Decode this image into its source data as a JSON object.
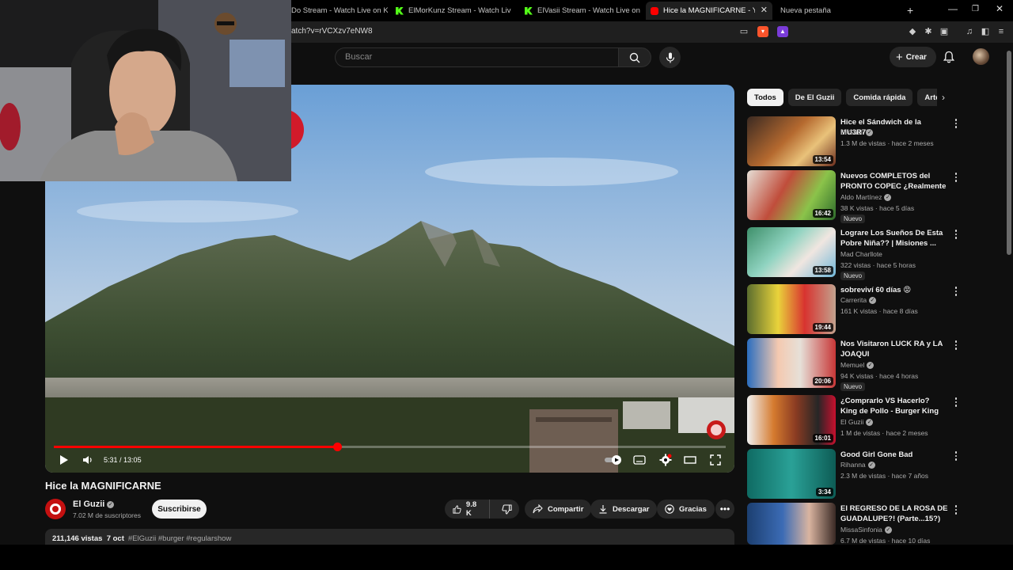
{
  "browser": {
    "tabs": [
      {
        "label": "Do Stream - Watch Live on Kick",
        "favicon": "kick-icon",
        "active": false
      },
      {
        "label": "ElMorKunz Stream - Watch Live on Kick",
        "favicon": "kick-icon",
        "active": false
      },
      {
        "label": "ElVasii Stream - Watch Live on Kick",
        "favicon": "kick-icon",
        "active": false
      },
      {
        "label": "Hice la MAGNIFICARNE - YouTube",
        "favicon": "youtube-icon",
        "active": true
      },
      {
        "label": "Nueva pestaña",
        "favicon": "",
        "active": false
      }
    ],
    "url": "atch?v=rVCXzv7eNW8"
  },
  "header": {
    "search_placeholder": "Buscar",
    "create_label": "Crear"
  },
  "video": {
    "title": "Hice la MAGNIFICARNE",
    "time_current": "5:31",
    "time_total": "13:05",
    "progress_fraction": 0.4218
  },
  "channel": {
    "name": "El Guzii",
    "subscribers": "7.02 M de suscriptores",
    "subscribe_label": "Suscribirse"
  },
  "actions": {
    "likes": "9.8 K",
    "share_label": "Compartir",
    "download_label": "Descargar",
    "thanks_label": "Gracias"
  },
  "description": {
    "views": "211,146 vistas",
    "date": "7 oct",
    "tags": "#ElGuzii #burger #regularshow"
  },
  "chips": [
    "Todos",
    "De El Guzii",
    "Comida rápida",
    "Arte cu"
  ],
  "recommendations": [
    {
      "title": "Hice el Sándwich de la MU3R73",
      "channel": "El Guzii",
      "verified": true,
      "meta": "1.3 M de vistas · hace 2 meses",
      "duration": "13:54",
      "badge": ""
    },
    {
      "title": "Nuevos COMPLETOS del PRONTO COPEC ¿Realmente ...",
      "channel": "Aldo Martínez",
      "verified": true,
      "meta": "38 K vistas · hace 5 días",
      "duration": "16:42",
      "badge": "Nuevo"
    },
    {
      "title": "Lograre Los Sueños De Esta Pobre Niña?? | Misiones ...",
      "channel": "Mad Charllote",
      "verified": false,
      "meta": "322 vistas · hace 5 horas",
      "duration": "13:58",
      "badge": "Nuevo"
    },
    {
      "title": "sobreviví 60 días 😡",
      "channel": "Carrerita",
      "verified": true,
      "meta": "161 K vistas · hace 8 días",
      "duration": "19:44",
      "badge": ""
    },
    {
      "title": "Nos Visitaron LUCK RA y LA JOAQUI",
      "channel": "Memuel",
      "verified": true,
      "meta": "94 K vistas · hace 4 horas",
      "duration": "20:06",
      "badge": "Nuevo"
    },
    {
      "title": "¿Comprarlo VS Hacerlo? King de Pollo - Burger King",
      "channel": "El Guzii",
      "verified": true,
      "meta": "1 M de vistas · hace 2 meses",
      "duration": "16:01",
      "badge": ""
    },
    {
      "title": "Good Girl Gone Bad",
      "channel": "Rihanna",
      "verified": true,
      "meta": "2.3 M de vistas · hace 7 años",
      "duration": "3:34",
      "badge": ""
    },
    {
      "title": "El REGRESO DE LA ROSA DE GUADALUPE?! (Parte...15?)",
      "channel": "MissaSinfonia",
      "verified": true,
      "meta": "6.7 M de vistas · hace 10 días",
      "duration": "",
      "badge": ""
    }
  ],
  "colors": {
    "background": "#0f0f0f",
    "accent_red": "#ff0000",
    "surface": "#272727"
  }
}
